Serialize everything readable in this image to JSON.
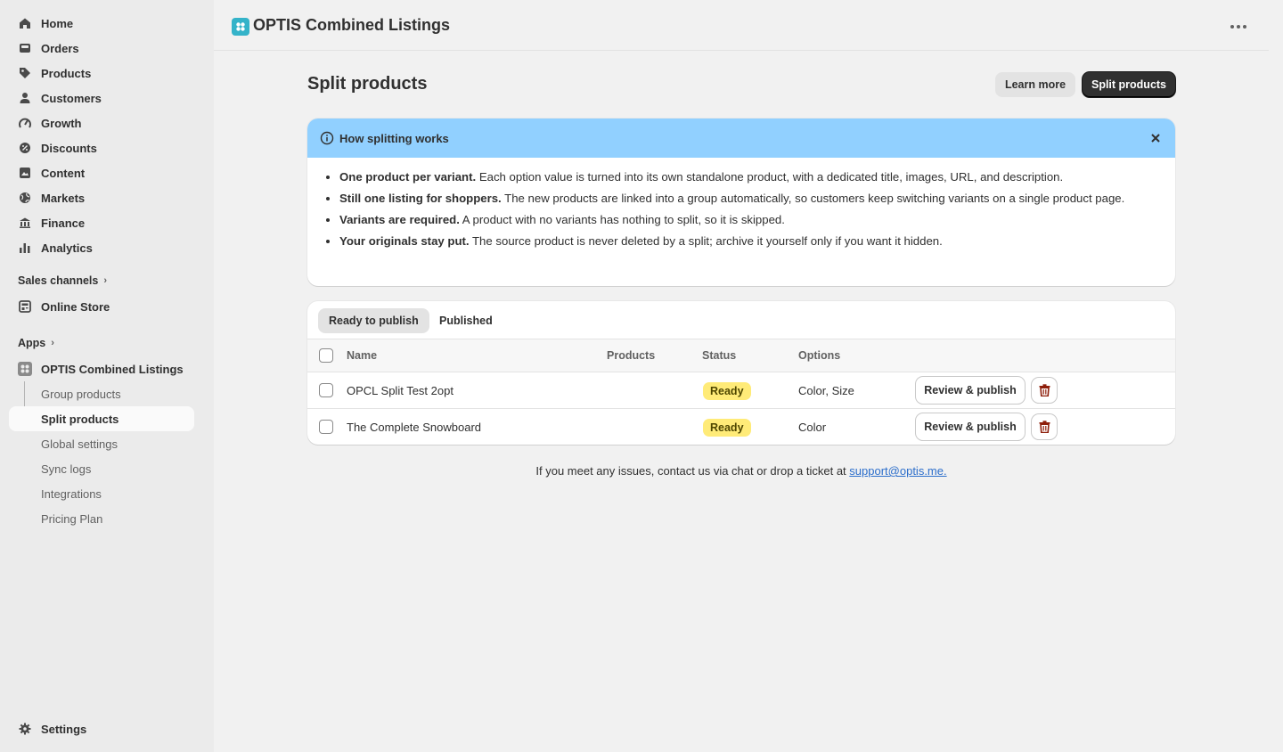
{
  "sidebar": {
    "items": [
      {
        "label": "Home",
        "icon": "home-icon"
      },
      {
        "label": "Orders",
        "icon": "orders-icon"
      },
      {
        "label": "Products",
        "icon": "tag-icon"
      },
      {
        "label": "Customers",
        "icon": "person-icon"
      },
      {
        "label": "Growth",
        "icon": "growth-icon"
      },
      {
        "label": "Discounts",
        "icon": "discount-icon"
      },
      {
        "label": "Content",
        "icon": "content-icon"
      },
      {
        "label": "Markets",
        "icon": "globe-icon"
      },
      {
        "label": "Finance",
        "icon": "bank-icon"
      },
      {
        "label": "Analytics",
        "icon": "bar-chart-icon"
      }
    ],
    "sales_channels_label": "Sales channels",
    "online_store_label": "Online Store",
    "apps_label": "Apps",
    "app_name": "OPTIS Combined Listings",
    "app_subitems": [
      {
        "label": "Group products"
      },
      {
        "label": "Split products"
      },
      {
        "label": "Global settings"
      },
      {
        "label": "Sync logs"
      },
      {
        "label": "Integrations"
      },
      {
        "label": "Pricing Plan"
      }
    ],
    "settings_label": "Settings"
  },
  "topbar": {
    "title": "OPTIS Combined Listings",
    "accent": "#34b3c9"
  },
  "page": {
    "title": "Split products",
    "learn_more_label": "Learn more",
    "split_products_label": "Split products"
  },
  "banner": {
    "title": "How splitting works",
    "color": "#91d0ff",
    "items": [
      {
        "bold": "One product per variant.",
        "text": " Each option value is turned into its own standalone product, with a dedicated title, images, URL, and description."
      },
      {
        "bold": "Still one listing for shoppers.",
        "text": " The new products are linked into a group automatically, so customers keep switching variants on a single product page."
      },
      {
        "bold": "Variants are required.",
        "text": " A product with no variants has nothing to split, so it is skipped."
      },
      {
        "bold": "Your originals stay put.",
        "text": " The source product is never deleted by a split; archive it yourself only if you want it hidden."
      }
    ]
  },
  "table": {
    "tabs": [
      {
        "label": "Ready to publish"
      },
      {
        "label": "Published"
      }
    ],
    "headers": {
      "name": "Name",
      "products": "Products",
      "status": "Status",
      "options": "Options"
    },
    "rows": [
      {
        "name": "OPCL Split Test 2opt",
        "products": "",
        "status": "Ready",
        "options": "Color, Size",
        "action": "Review & publish"
      },
      {
        "name": "The Complete Snowboard",
        "products": "",
        "status": "Ready",
        "options": "Color",
        "action": "Review & publish"
      }
    ],
    "badge_color": "#ffeb78"
  },
  "footer": {
    "text": "If you meet any issues, contact us via chat or drop a ticket at ",
    "link": "support@optis.me."
  }
}
